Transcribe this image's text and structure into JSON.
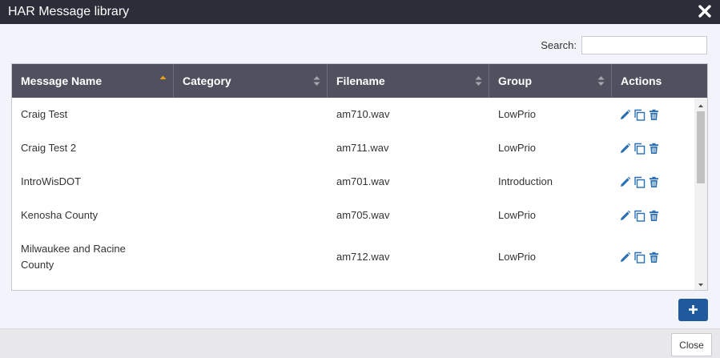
{
  "dialog": {
    "title": "HAR Message library"
  },
  "search": {
    "label": "Search:",
    "value": "",
    "placeholder": ""
  },
  "table": {
    "columns": [
      {
        "label": "Message Name",
        "sort": "asc"
      },
      {
        "label": "Category",
        "sort": "none"
      },
      {
        "label": "Filename",
        "sort": "none"
      },
      {
        "label": "Group",
        "sort": "none"
      },
      {
        "label": "Actions",
        "sort": null
      }
    ],
    "rows": [
      {
        "name": "Craig Test",
        "category": "",
        "filename": "am710.wav",
        "group": "LowPrio"
      },
      {
        "name": "Craig Test 2",
        "category": "",
        "filename": "am711.wav",
        "group": "LowPrio"
      },
      {
        "name": "IntroWisDOT",
        "category": "",
        "filename": "am701.wav",
        "group": "Introduction"
      },
      {
        "name": "Kenosha County",
        "category": "",
        "filename": "am705.wav",
        "group": "LowPrio"
      },
      {
        "name": "Milwaukee and Racine County",
        "category": "",
        "filename": "am712.wav",
        "group": "LowPrio"
      }
    ],
    "row_actions": [
      "edit-icon",
      "copy-icon",
      "delete-icon"
    ]
  },
  "buttons": {
    "add_icon": "plus-icon",
    "close_label": "Close"
  },
  "colors": {
    "title_bar": "#2b2d38",
    "table_header": "#4f525e",
    "sort_active": "#f39c12",
    "action_icons": "#2a6fb3",
    "primary_button": "#1e5a9c"
  }
}
